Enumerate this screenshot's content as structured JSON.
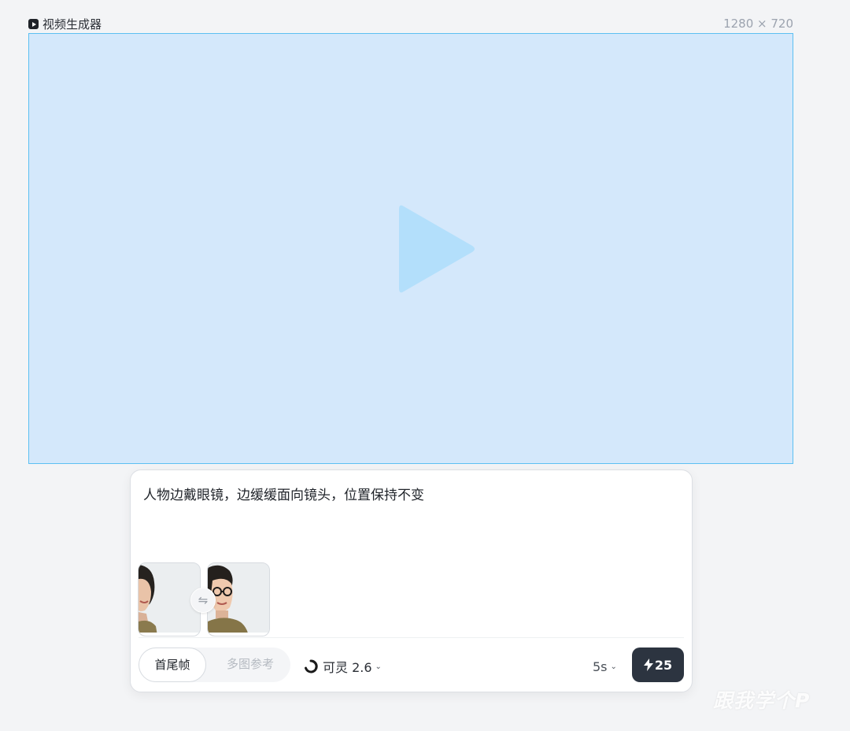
{
  "canvas": {
    "title": "视频生成器",
    "title_icon": "video-icon",
    "size_label": "1280 × 720"
  },
  "preview": {
    "background": "#d4e8fb",
    "border_color": "#5cc0f2",
    "icon": "play-icon",
    "icon_color": "#b3dffb"
  },
  "prompt": {
    "text": "人物边戴眼镜，边缓缓面向镜头，位置保持不变"
  },
  "frames": {
    "first_frame": "first-frame-image",
    "last_frame": "last-frame-image",
    "swap_icon": "⇋"
  },
  "toolbar": {
    "mode_options": [
      "首尾帧",
      "多图参考"
    ],
    "selected_mode": "首尾帧",
    "model_label": "可灵 2.6",
    "model_icon": "kling-logo-icon",
    "duration_label": "5s",
    "generate_credits": "25",
    "generate_icon": "bolt-icon",
    "generate_color": "#2c3440"
  },
  "watermark": {
    "text": "跟我学个P"
  }
}
